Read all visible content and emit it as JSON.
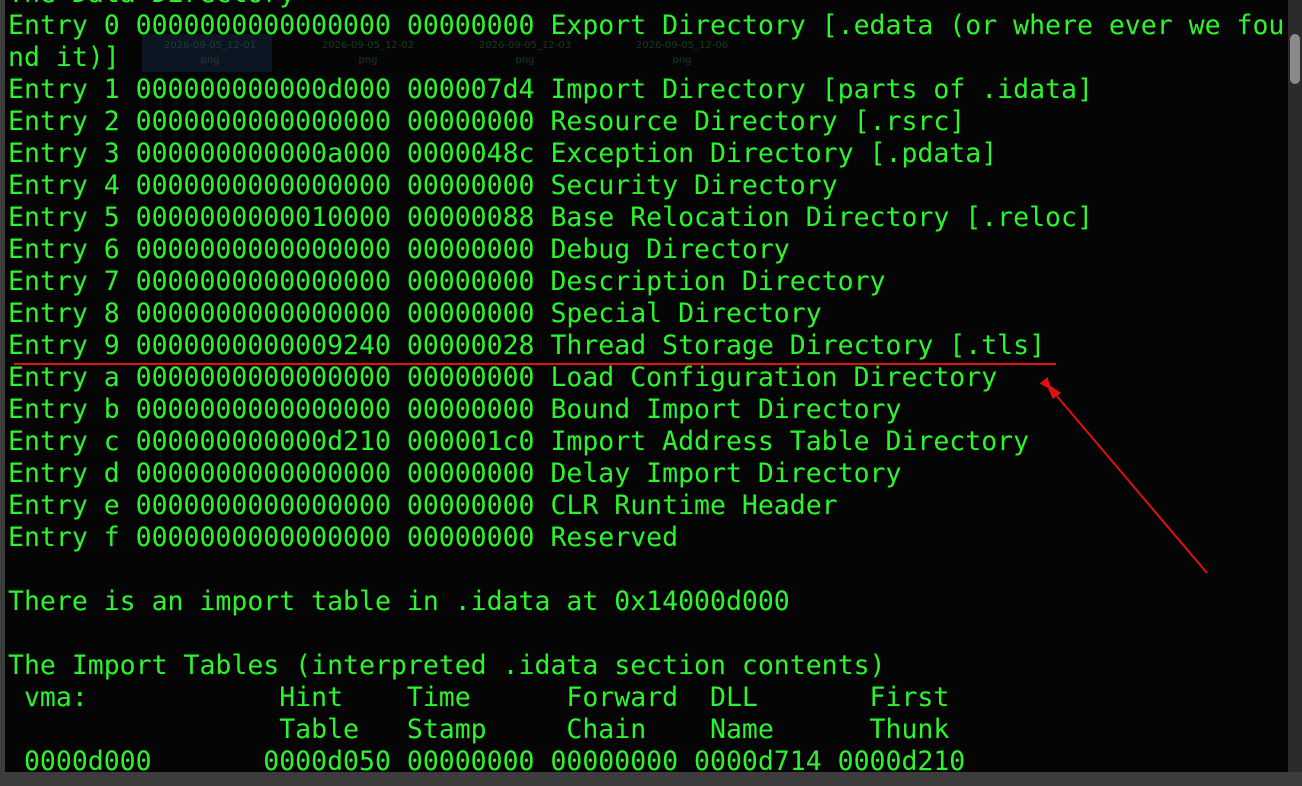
{
  "terminal": {
    "lines": [
      "The Data Directory",
      "Entry 0 0000000000000000 00000000 Export Directory [.edata (or where ever we fou",
      "nd it)]",
      "Entry 1 000000000000d000 000007d4 Import Directory [parts of .idata]",
      "Entry 2 0000000000000000 00000000 Resource Directory [.rsrc]",
      "Entry 3 000000000000a000 0000048c Exception Directory [.pdata]",
      "Entry 4 0000000000000000 00000000 Security Directory",
      "Entry 5 0000000000010000 00000088 Base Relocation Directory [.reloc]",
      "Entry 6 0000000000000000 00000000 Debug Directory",
      "Entry 7 0000000000000000 00000000 Description Directory",
      "Entry 8 0000000000000000 00000000 Special Directory",
      "Entry 9 0000000000009240 00000028 Thread Storage Directory [.tls]",
      "Entry a 0000000000000000 00000000 Load Configuration Directory",
      "Entry b 0000000000000000 00000000 Bound Import Directory",
      "Entry c 000000000000d210 000001c0 Import Address Table Directory",
      "Entry d 0000000000000000 00000000 Delay Import Directory",
      "Entry e 0000000000000000 00000000 CLR Runtime Header",
      "Entry f 0000000000000000 00000000 Reserved",
      "",
      "There is an import table in .idata at 0x14000d000",
      "",
      "The Import Tables (interpreted .idata section contents)",
      " vma:            Hint    Time      Forward  DLL       First",
      "                 Table   Stamp     Chain    Name      Thunk",
      " 0000d000       0000d050 00000000 00000000 0000d714 0000d210"
    ]
  },
  "background_thumbnails": [
    {
      "name": "2026-09-05_12-01",
      "ext": "png"
    },
    {
      "name": "2026-09-05_12-02",
      "ext": "png"
    },
    {
      "name": "2026-09-05_12-03",
      "ext": "png"
    },
    {
      "name": "2026-09-05_12-06",
      "ext": "png"
    }
  ],
  "annotation": {
    "highlighted_entry": "Entry 9",
    "color": "#e01010"
  },
  "colors": {
    "terminal_bg": "#050505",
    "terminal_fg": "#2df52d",
    "frame": "#3c3c3c"
  }
}
